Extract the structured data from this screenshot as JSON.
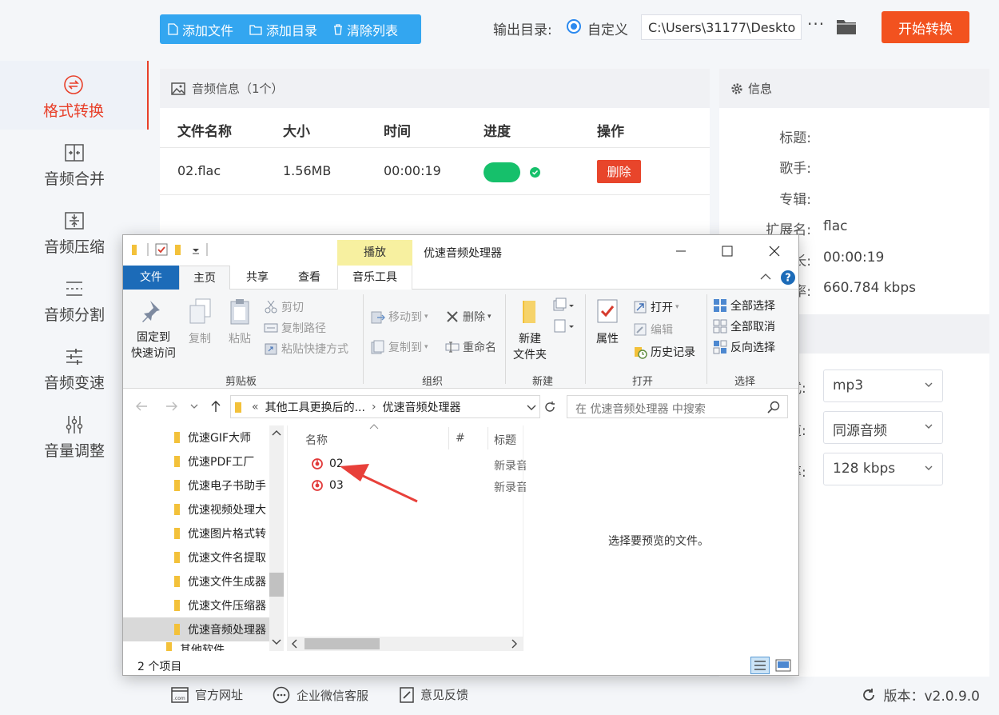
{
  "sidebar": {
    "items": [
      {
        "label": "格式转换",
        "icon": "format-convert-icon",
        "active": true
      },
      {
        "label": "音频合并",
        "icon": "merge-icon"
      },
      {
        "label": "音频压缩",
        "icon": "compress-icon"
      },
      {
        "label": "音频分割",
        "icon": "split-icon"
      },
      {
        "label": "音频变速",
        "icon": "speed-icon"
      },
      {
        "label": "音量调整",
        "icon": "volume-icon"
      }
    ]
  },
  "toolbar": {
    "add_file": "添加文件",
    "add_dir": "添加目录",
    "clear_list": "清除列表",
    "output_label": "输出目录:",
    "radio_custom": "自定义",
    "output_path": "C:\\Users\\31177\\Deskto",
    "more": "···",
    "start": "开始转换"
  },
  "list": {
    "header": "音频信息（1个）",
    "columns": [
      "文件名称",
      "大小",
      "时间",
      "进度",
      "操作"
    ],
    "rows": [
      {
        "name": "02.flac",
        "size": "1.56MB",
        "time": "00:00:19",
        "progress": 1.0,
        "action": "删除"
      }
    ]
  },
  "info": {
    "header": "信息",
    "fields": [
      {
        "key": "标题:",
        "value": ""
      },
      {
        "key": "歌手:",
        "value": ""
      },
      {
        "key": "专辑:",
        "value": ""
      },
      {
        "key": "扩展名:",
        "value": "flac"
      },
      {
        "key": "长:",
        "value": "00:00:19"
      },
      {
        "key": "率:",
        "value": "660.784 kbps"
      }
    ],
    "settings": [
      {
        "label": "式:",
        "value": "mp3"
      },
      {
        "label": "道:",
        "value": "同源音频"
      },
      {
        "label": "率:",
        "value": "128 kbps"
      }
    ]
  },
  "footer": {
    "website": "官方网址",
    "wechat": "企业微信客服",
    "feedback": "意见反馈",
    "version": "版本：v2.0.9.0"
  },
  "explorer": {
    "context_tab": "播放",
    "title": "优速音频处理器",
    "tabs": {
      "file": "文件",
      "home": "主页",
      "share": "共享",
      "view": "查看",
      "music": "音乐工具"
    },
    "ribbon": {
      "pin": "固定到",
      "pin2": "快速访问",
      "copy": "复制",
      "paste": "粘贴",
      "cut": "剪切",
      "copy_path": "复制路径",
      "paste_shortcut": "粘贴快捷方式",
      "clipboard": "剪贴板",
      "move_to": "移动到",
      "copy_to": "复制到",
      "delete": "删除",
      "rename": "重命名",
      "organize": "组织",
      "new_folder": "新建",
      "new_folder2": "文件夹",
      "new": "新建",
      "properties": "属性",
      "open": "打开",
      "edit": "编辑",
      "history": "历史记录",
      "open_group": "打开",
      "select_all": "全部选择",
      "select_none": "全部取消",
      "invert": "反向选择",
      "select": "选择"
    },
    "address": {
      "prefix": "«",
      "part1": "其他工具更换后的...",
      "part2": "优速音频处理器"
    },
    "search_placeholder": "在 优速音频处理器 中搜索",
    "tree": [
      {
        "label": "优速GIF大师"
      },
      {
        "label": "优速PDF工厂"
      },
      {
        "label": "优速电子书助手"
      },
      {
        "label": "优速视频处理大"
      },
      {
        "label": "优速图片格式转"
      },
      {
        "label": "优速文件名提取"
      },
      {
        "label": "优速文件生成器"
      },
      {
        "label": "优速文件压缩器"
      },
      {
        "label": "优速音频处理器",
        "selected": true
      },
      {
        "label": "其他软件"
      }
    ],
    "columns": {
      "name": "名称",
      "num": "#",
      "title": "标题"
    },
    "files": [
      {
        "name": "02",
        "title": "新录音"
      },
      {
        "name": "03",
        "title": "新录音"
      }
    ],
    "preview_text": "选择要预览的文件。",
    "status": "2 个项目"
  }
}
